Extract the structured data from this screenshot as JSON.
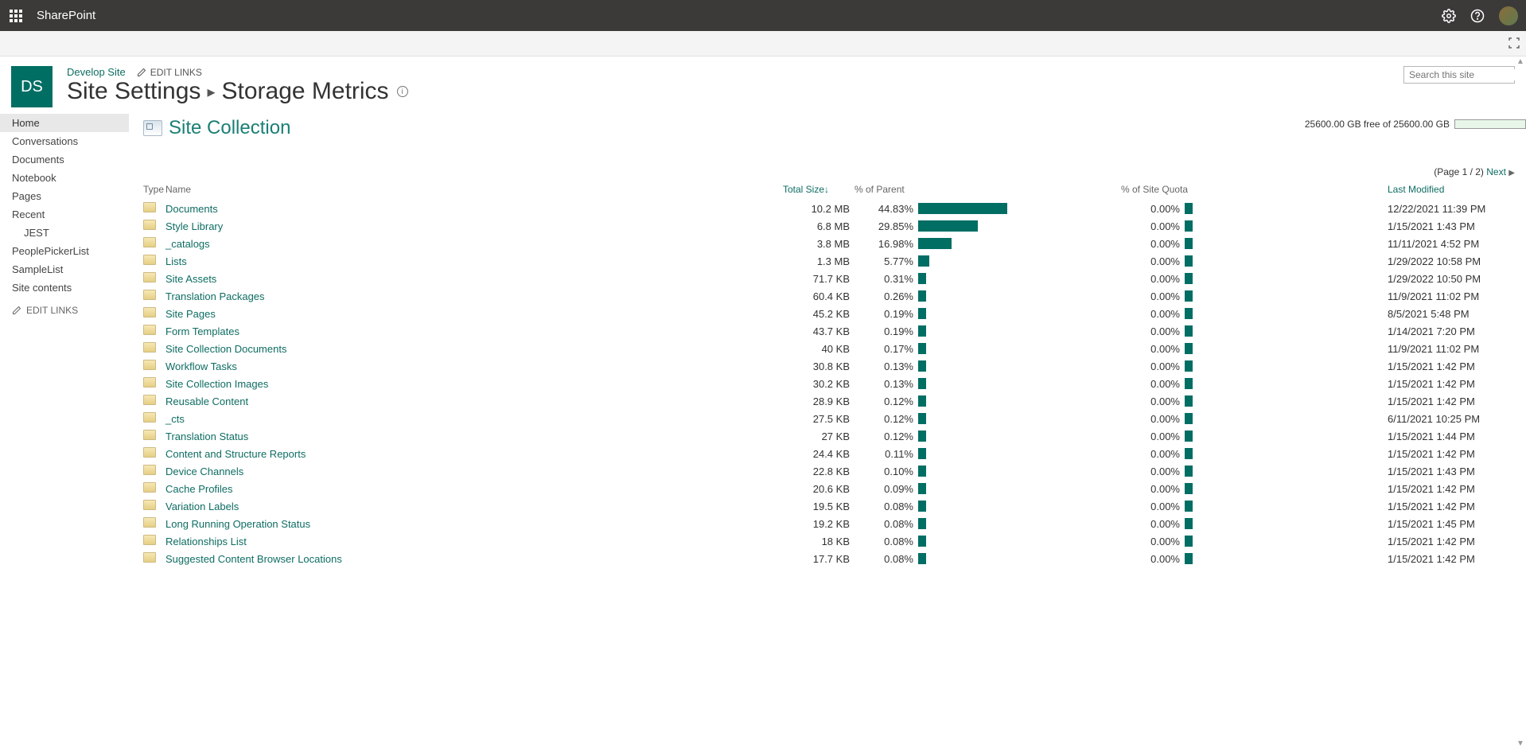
{
  "topbar": {
    "brand": "SharePoint"
  },
  "site": {
    "badge": "DS",
    "link": "Develop Site",
    "edit_links": "EDIT LINKS"
  },
  "title": {
    "part1": "Site Settings",
    "part2": "Storage Metrics"
  },
  "search": {
    "placeholder": "Search this site"
  },
  "leftnav": {
    "items": [
      {
        "label": "Home",
        "selected": true
      },
      {
        "label": "Conversations"
      },
      {
        "label": "Documents"
      },
      {
        "label": "Notebook"
      },
      {
        "label": "Pages"
      },
      {
        "label": "Recent"
      },
      {
        "label": "JEST",
        "sub": true
      },
      {
        "label": "PeoplePickerList"
      },
      {
        "label": "SampleList"
      },
      {
        "label": "Site contents"
      }
    ],
    "edit_links": "EDIT LINKS"
  },
  "sc_heading": "Site Collection",
  "quota": {
    "text": "25600.00 GB free of 25600.00 GB"
  },
  "paging": {
    "text": "(Page 1 / 2)",
    "next": "Next"
  },
  "columns": {
    "type": "Type",
    "name": "Name",
    "total_size": "Total Size",
    "pct_parent": "% of Parent",
    "pct_quota": "% of Site Quota",
    "modified": "Last Modified"
  },
  "rows": [
    {
      "name": "Documents",
      "size": "10.2 MB",
      "pparent": "44.83%",
      "pbar": 44.83,
      "quota": "0.00%",
      "modified": "12/22/2021 11:39 PM"
    },
    {
      "name": "Style Library",
      "size": "6.8 MB",
      "pparent": "29.85%",
      "pbar": 29.85,
      "quota": "0.00%",
      "modified": "1/15/2021 1:43 PM"
    },
    {
      "name": "_catalogs",
      "size": "3.8 MB",
      "pparent": "16.98%",
      "pbar": 16.98,
      "quota": "0.00%",
      "modified": "11/11/2021 4:52 PM"
    },
    {
      "name": "Lists",
      "size": "1.3 MB",
      "pparent": "5.77%",
      "pbar": 5.77,
      "quota": "0.00%",
      "modified": "1/29/2022 10:58 PM"
    },
    {
      "name": "Site Assets",
      "size": "71.7 KB",
      "pparent": "0.31%",
      "pbar": 0.31,
      "quota": "0.00%",
      "modified": "1/29/2022 10:50 PM"
    },
    {
      "name": "Translation Packages",
      "size": "60.4 KB",
      "pparent": "0.26%",
      "pbar": 0.26,
      "quota": "0.00%",
      "modified": "11/9/2021 11:02 PM"
    },
    {
      "name": "Site Pages",
      "size": "45.2 KB",
      "pparent": "0.19%",
      "pbar": 0.19,
      "quota": "0.00%",
      "modified": "8/5/2021 5:48 PM"
    },
    {
      "name": "Form Templates",
      "size": "43.7 KB",
      "pparent": "0.19%",
      "pbar": 0.19,
      "quota": "0.00%",
      "modified": "1/14/2021 7:20 PM"
    },
    {
      "name": "Site Collection Documents",
      "size": "40 KB",
      "pparent": "0.17%",
      "pbar": 0.17,
      "quota": "0.00%",
      "modified": "11/9/2021 11:02 PM"
    },
    {
      "name": "Workflow Tasks",
      "size": "30.8 KB",
      "pparent": "0.13%",
      "pbar": 0.13,
      "quota": "0.00%",
      "modified": "1/15/2021 1:42 PM"
    },
    {
      "name": "Site Collection Images",
      "size": "30.2 KB",
      "pparent": "0.13%",
      "pbar": 0.13,
      "quota": "0.00%",
      "modified": "1/15/2021 1:42 PM"
    },
    {
      "name": "Reusable Content",
      "size": "28.9 KB",
      "pparent": "0.12%",
      "pbar": 0.12,
      "quota": "0.00%",
      "modified": "1/15/2021 1:42 PM"
    },
    {
      "name": "_cts",
      "size": "27.5 KB",
      "pparent": "0.12%",
      "pbar": 0.12,
      "quota": "0.00%",
      "modified": "6/11/2021 10:25 PM"
    },
    {
      "name": "Translation Status",
      "size": "27 KB",
      "pparent": "0.12%",
      "pbar": 0.12,
      "quota": "0.00%",
      "modified": "1/15/2021 1:44 PM"
    },
    {
      "name": "Content and Structure Reports",
      "size": "24.4 KB",
      "pparent": "0.11%",
      "pbar": 0.11,
      "quota": "0.00%",
      "modified": "1/15/2021 1:42 PM"
    },
    {
      "name": "Device Channels",
      "size": "22.8 KB",
      "pparent": "0.10%",
      "pbar": 0.1,
      "quota": "0.00%",
      "modified": "1/15/2021 1:43 PM"
    },
    {
      "name": "Cache Profiles",
      "size": "20.6 KB",
      "pparent": "0.09%",
      "pbar": 0.09,
      "quota": "0.00%",
      "modified": "1/15/2021 1:42 PM"
    },
    {
      "name": "Variation Labels",
      "size": "19.5 KB",
      "pparent": "0.08%",
      "pbar": 0.08,
      "quota": "0.00%",
      "modified": "1/15/2021 1:42 PM"
    },
    {
      "name": "Long Running Operation Status",
      "size": "19.2 KB",
      "pparent": "0.08%",
      "pbar": 0.08,
      "quota": "0.00%",
      "modified": "1/15/2021 1:45 PM"
    },
    {
      "name": "Relationships List",
      "size": "18 KB",
      "pparent": "0.08%",
      "pbar": 0.08,
      "quota": "0.00%",
      "modified": "1/15/2021 1:42 PM"
    },
    {
      "name": "Suggested Content Browser Locations",
      "size": "17.7 KB",
      "pparent": "0.08%",
      "pbar": 0.08,
      "quota": "0.00%",
      "modified": "1/15/2021 1:42 PM"
    }
  ]
}
